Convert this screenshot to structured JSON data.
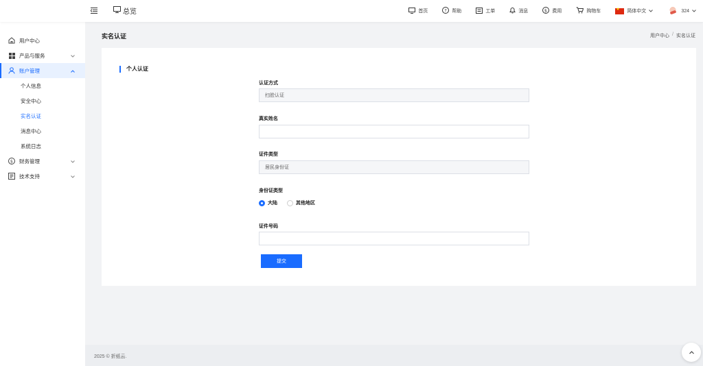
{
  "topbar": {
    "overview_label": "总览",
    "items": [
      {
        "icon": "monitor-icon",
        "label": "首页"
      },
      {
        "icon": "help-icon",
        "label": "帮助"
      },
      {
        "icon": "ticket-icon",
        "label": "工单"
      },
      {
        "icon": "bell-icon",
        "label": "消息"
      },
      {
        "icon": "dollar-icon",
        "label": "费用"
      },
      {
        "icon": "cart-icon",
        "label": "购物车"
      }
    ],
    "language": "简体中文",
    "user_name": "324"
  },
  "sidebar": {
    "items": [
      {
        "label": "用户中心",
        "icon": "home-icon"
      },
      {
        "label": "产品与服务",
        "icon": "grid-icon"
      },
      {
        "label": "账户管理",
        "icon": "user-icon"
      },
      {
        "label": "财务管理",
        "icon": "dollar-circle-icon"
      },
      {
        "label": "技术支持",
        "icon": "document-icon"
      }
    ],
    "sub_items": [
      "个人信息",
      "安全中心",
      "实名认证",
      "消息中心",
      "系统日志"
    ]
  },
  "page": {
    "title": "实名认证",
    "breadcrumb": [
      "用户中心",
      "实名认证"
    ],
    "breadcrumb_sep": "/"
  },
  "form": {
    "section_title": "个人认证",
    "auth_method_label": "认证方式",
    "auth_method_value": "扫脸认证",
    "real_name_label": "真实姓名",
    "real_name_value": "",
    "cert_type_label": "证件类型",
    "cert_type_value": "居民身份证",
    "id_region_label": "身份证类型",
    "region_options": [
      "大陆",
      "其他地区"
    ],
    "cert_number_label": "证件号码",
    "cert_number_value": "",
    "submit_label": "提交"
  },
  "footer": {
    "text": "2025 © 折纸云."
  },
  "colors": {
    "accent": "#1a6cff"
  }
}
